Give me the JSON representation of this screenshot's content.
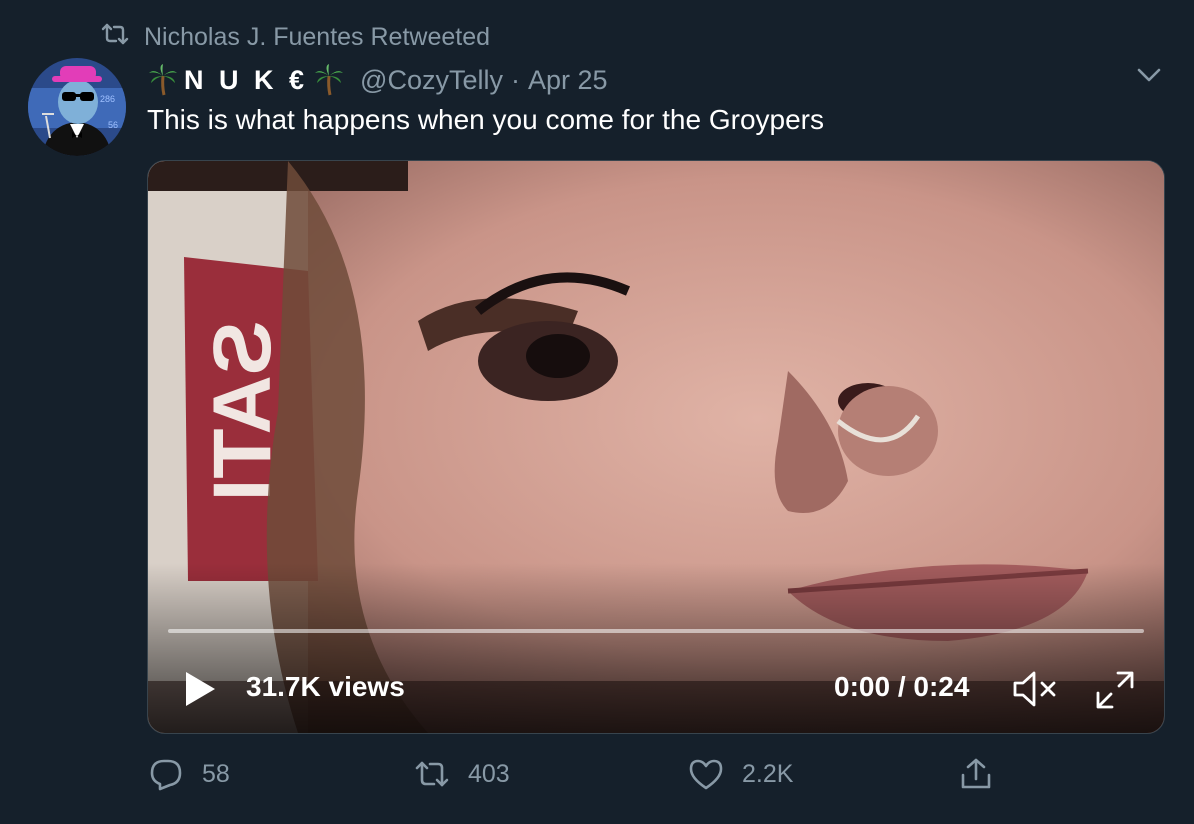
{
  "retweet_banner": {
    "text": "Nicholas J. Fuentes Retweeted",
    "icon": "retweet-icon"
  },
  "tweet": {
    "display_name": "N U K €",
    "handle": "@CozyTelly",
    "separator": "·",
    "date": "Apr 25",
    "text": "This is what happens when you come for the Groypers",
    "menu_icon": "chevron-down-icon"
  },
  "video": {
    "views": "31.7K views",
    "time": "0:00 / 0:24",
    "progress": 0,
    "background_sign_text": "SATI"
  },
  "actions": {
    "reply_count": "58",
    "retweet_count": "403",
    "like_count": "2.2K"
  },
  "colors": {
    "background": "#15202b",
    "muted": "#8899a6",
    "border": "#38444d",
    "text": "#ffffff"
  }
}
